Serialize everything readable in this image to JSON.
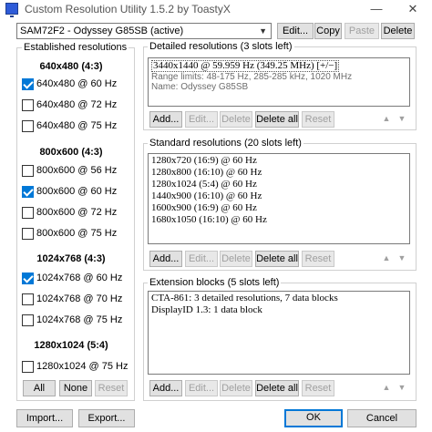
{
  "window": {
    "title": "Custom Resolution Utility 1.5.2 by ToastyX",
    "minimize": "—",
    "close": "✕"
  },
  "monitor_select": {
    "value": "SAM72F2 - Odyssey G85SB (active)"
  },
  "top_buttons": {
    "edit": "Edit...",
    "copy": "Copy",
    "paste": "Paste",
    "delete": "Delete"
  },
  "established": {
    "title": "Established resolutions",
    "groups": [
      {
        "heading": "640x480 (4:3)",
        "items": [
          {
            "label": "640x480 @ 60 Hz",
            "checked": true
          },
          {
            "label": "640x480 @ 72 Hz",
            "checked": false
          },
          {
            "label": "640x480 @ 75 Hz",
            "checked": false
          }
        ]
      },
      {
        "heading": "800x600 (4:3)",
        "items": [
          {
            "label": "800x600 @ 56 Hz",
            "checked": false
          },
          {
            "label": "800x600 @ 60 Hz",
            "checked": true
          },
          {
            "label": "800x600 @ 72 Hz",
            "checked": false
          },
          {
            "label": "800x600 @ 75 Hz",
            "checked": false
          }
        ]
      },
      {
        "heading": "1024x768 (4:3)",
        "items": [
          {
            "label": "1024x768 @ 60 Hz",
            "checked": true
          },
          {
            "label": "1024x768 @ 70 Hz",
            "checked": false
          },
          {
            "label": "1024x768 @ 75 Hz",
            "checked": false
          }
        ]
      },
      {
        "heading": "1280x1024 (5:4)",
        "items": [
          {
            "label": "1280x1024 @ 75 Hz",
            "checked": false
          }
        ]
      }
    ],
    "buttons": {
      "all": "All",
      "none": "None",
      "reset": "Reset"
    }
  },
  "detailed": {
    "title": "Detailed resolutions (3 slots left)",
    "line1": "3440x1440 @ 59.959 Hz (349.25 MHz) [+/−]",
    "line2": "Range limits: 48-175 Hz, 285-285 kHz, 1020 MHz",
    "line3": "Name: Odyssey G85SB"
  },
  "standard": {
    "title": "Standard resolutions (20 slots left)",
    "items": [
      "1280x720 (16:9) @ 60 Hz",
      "1280x800 (16:10) @ 60 Hz",
      "1280x1024 (5:4) @ 60 Hz",
      "1440x900 (16:10) @ 60 Hz",
      "1600x900 (16:9) @ 60 Hz",
      "1680x1050 (16:10) @ 60 Hz"
    ]
  },
  "extension": {
    "title": "Extension blocks (5 slots left)",
    "items": [
      "CTA-861: 3 detailed resolutions, 7 data blocks",
      "DisplayID 1.3: 1 data block"
    ]
  },
  "list_buttons": {
    "add": "Add...",
    "edit": "Edit...",
    "delete": "Delete",
    "delete_all": "Delete all",
    "reset": "Reset",
    "up": "▲",
    "down": "▼"
  },
  "bottom_buttons": {
    "import": "Import...",
    "export": "Export...",
    "ok": "OK",
    "cancel": "Cancel"
  },
  "colors": {
    "accent": "#0078d7"
  }
}
